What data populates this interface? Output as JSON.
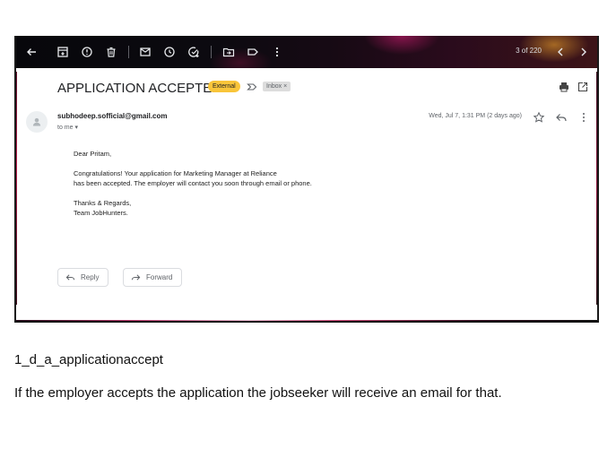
{
  "toolbar": {
    "counter": "3 of 220",
    "icons": [
      "back-arrow-icon",
      "archive-icon",
      "report-spam-icon",
      "delete-icon",
      "mark-unread-icon",
      "snooze-icon",
      "add-to-tasks-icon",
      "move-to-icon",
      "labels-icon",
      "more-vert-icon",
      "newer-chevron-icon",
      "older-chevron-icon"
    ]
  },
  "email": {
    "subject": "APPLICATION ACCEPTED!",
    "external_badge": "External",
    "inbox_badge": "Inbox ×",
    "sender": "subhodeep.sofficial@gmail.com",
    "to_me": "to me ▾",
    "date": "Wed, Jul 7, 1:31 PM (2 days ago)",
    "greeting": "Dear Pritam,",
    "body_line1": "Congratulations! Your application for Marketing Manager at Reliance",
    "body_line2": "has been accepted. The employer will contact you soon through email or phone.",
    "signoff": "Thanks & Regards,",
    "signature": "Team JobHunters.",
    "reply_label": "Reply",
    "forward_label": "Forward"
  },
  "caption": {
    "title": "1_d_a_applicationaccept",
    "description": "If the employer accepts the application the jobseeker will receive an email for that."
  },
  "colors": {
    "external_badge": "#f9c53a",
    "inbox_badge": "#dddddd",
    "toolbar_dark": "#0c0a10"
  }
}
